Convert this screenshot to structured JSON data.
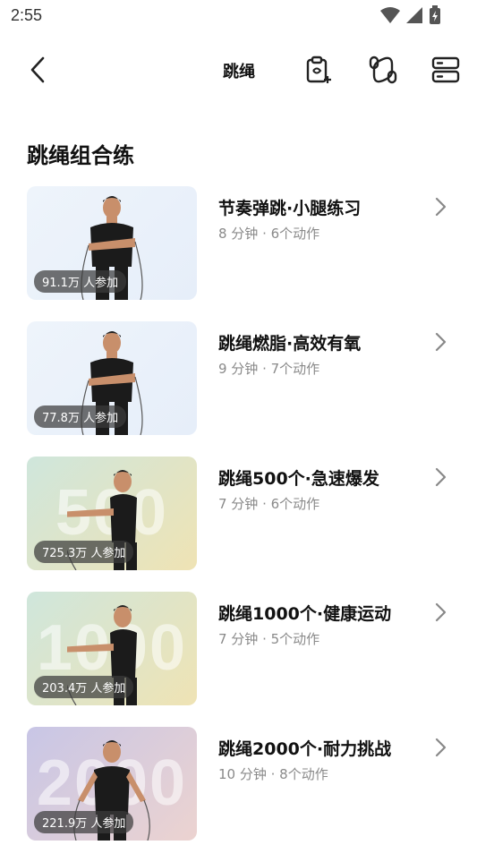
{
  "status": {
    "time": "2:55"
  },
  "header": {
    "title": "跳绳"
  },
  "section": {
    "title": "跳绳组合练"
  },
  "courses": [
    {
      "title": "节奏弹跳·小腿练习",
      "meta": "8 分钟 · 6个动作",
      "participants": "91.1万 人参加",
      "bg_number": "",
      "bg_colors": [
        "#eef4fb",
        "#e6eef9"
      ]
    },
    {
      "title": "跳绳燃脂·高效有氧",
      "meta": "9 分钟 · 7个动作",
      "participants": "77.8万 人参加",
      "bg_number": "",
      "bg_colors": [
        "#eef4fb",
        "#e6eef9"
      ]
    },
    {
      "title": "跳绳500个·急速爆发",
      "meta": "7 分钟 · 6个动作",
      "participants": "725.3万 人参加",
      "bg_number": "500",
      "bg_colors": [
        "#cfe6dc",
        "#efe3b4"
      ]
    },
    {
      "title": "跳绳1000个·健康运动",
      "meta": "7 分钟 · 5个动作",
      "participants": "203.4万 人参加",
      "bg_number": "1000",
      "bg_colors": [
        "#cfe6dc",
        "#efe3b4"
      ]
    },
    {
      "title": " 跳绳2000个·耐力挑战",
      "meta": "10 分钟 · 8个动作",
      "participants": "221.9万 人参加",
      "bg_number": "2000",
      "bg_colors": [
        "#c8c6e6",
        "#ecd3d0"
      ]
    }
  ],
  "icons": {
    "back": "back-arrow-icon",
    "toolbar": [
      "clipboard-plan-icon",
      "jump-rope-icon",
      "list-layout-icon"
    ]
  }
}
